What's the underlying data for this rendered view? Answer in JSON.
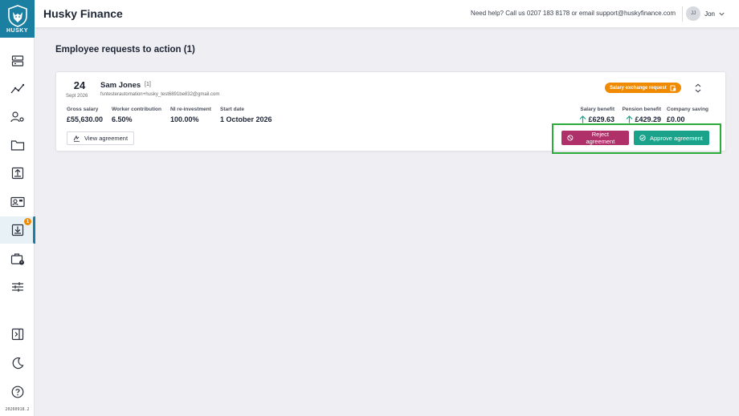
{
  "app": {
    "title": "Husky Finance",
    "logo_text": "HUSKY",
    "version": "20260918.2"
  },
  "header": {
    "help_text": "Need help? Call us 0207 183 8178 or email support@huskyfinance.com",
    "user_initials": "JJ",
    "user_name": "Jon"
  },
  "sidebar": {
    "items": [
      {
        "icon": "servers-icon"
      },
      {
        "icon": "trend-icon"
      },
      {
        "icon": "users-settings-icon"
      },
      {
        "icon": "folder-icon"
      },
      {
        "icon": "upload-icon"
      },
      {
        "icon": "id-card-icon"
      },
      {
        "icon": "inbox-download-icon",
        "active": true,
        "badge": "1"
      },
      {
        "icon": "briefcase-clock-icon"
      },
      {
        "icon": "sliders-icon"
      },
      {
        "icon": "panel-toggle-icon"
      },
      {
        "icon": "moon-icon"
      },
      {
        "icon": "help-icon"
      }
    ]
  },
  "main": {
    "section_title": "Employee requests to action (1)",
    "request": {
      "day": "24",
      "month_year": "Sept 2026",
      "name": "Sam Jones",
      "count": "[1]",
      "email": "fsntesterautomation+husky_test6891be832@gmail.com",
      "type_label": "Salary exchange request",
      "fields": [
        {
          "label": "Gross salary",
          "value": "£55,630.00"
        },
        {
          "label": "Worker contribution",
          "value": "6.50%"
        },
        {
          "label": "NI re-investment",
          "value": "100.00%"
        },
        {
          "label": "Start date",
          "value": "1 October 2026"
        }
      ],
      "benefits": [
        {
          "label": "Salary benefit",
          "value": "£629.63",
          "arrow": true
        },
        {
          "label": "Pension benefit",
          "value": "£429.29",
          "arrow": true
        },
        {
          "label": "Company saving",
          "value": "£0.00",
          "arrow": false
        }
      ],
      "view_label": "View agreement",
      "reject_label": "Reject agreement",
      "approve_label": "Approve agreement"
    }
  },
  "colors": {
    "brand": "#1a7fa0",
    "pill": "#f08a00",
    "reject": "#b0306a",
    "approve": "#1aa38a",
    "arrow": "#1aa38a",
    "highlight": "#2aab3a"
  }
}
